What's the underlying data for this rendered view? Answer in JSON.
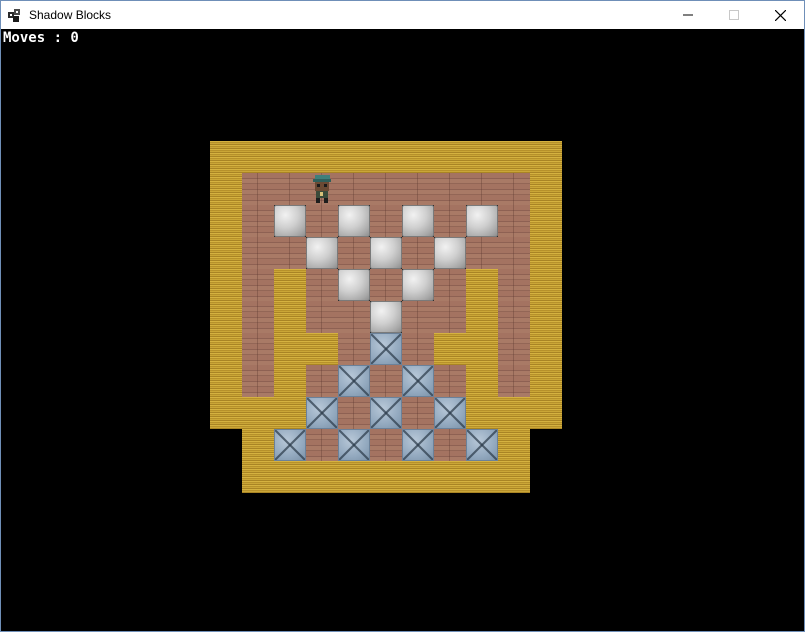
{
  "window": {
    "title": "Shadow Blocks",
    "minimize_glyph": "—",
    "maximize_glyph": "☐",
    "close_glyph": "✕"
  },
  "hud": {
    "moves_text": "Moves : 0"
  },
  "colors": {
    "wall": "#c9a435",
    "floor": "#a47361",
    "goal": "#93a9bf",
    "box": "#cfcfcf",
    "background": "#000000"
  },
  "level": {
    "legend": {
      "#": "wall",
      "_": "floor",
      "O": "goal",
      "B": "box",
      "@": "player",
      " ": "empty"
    },
    "rows": [
      "###########",
      "#__@______#",
      "#_B_B_B_B_#",
      "#__B_B_B__#",
      "#_#_B_B_#_#",
      "#_#__B__#_#",
      "#_##_O_##_#",
      "#_#_O_O_#_#",
      "###O_O_O###",
      " #O_O_O_O# ",
      " ######### "
    ]
  }
}
